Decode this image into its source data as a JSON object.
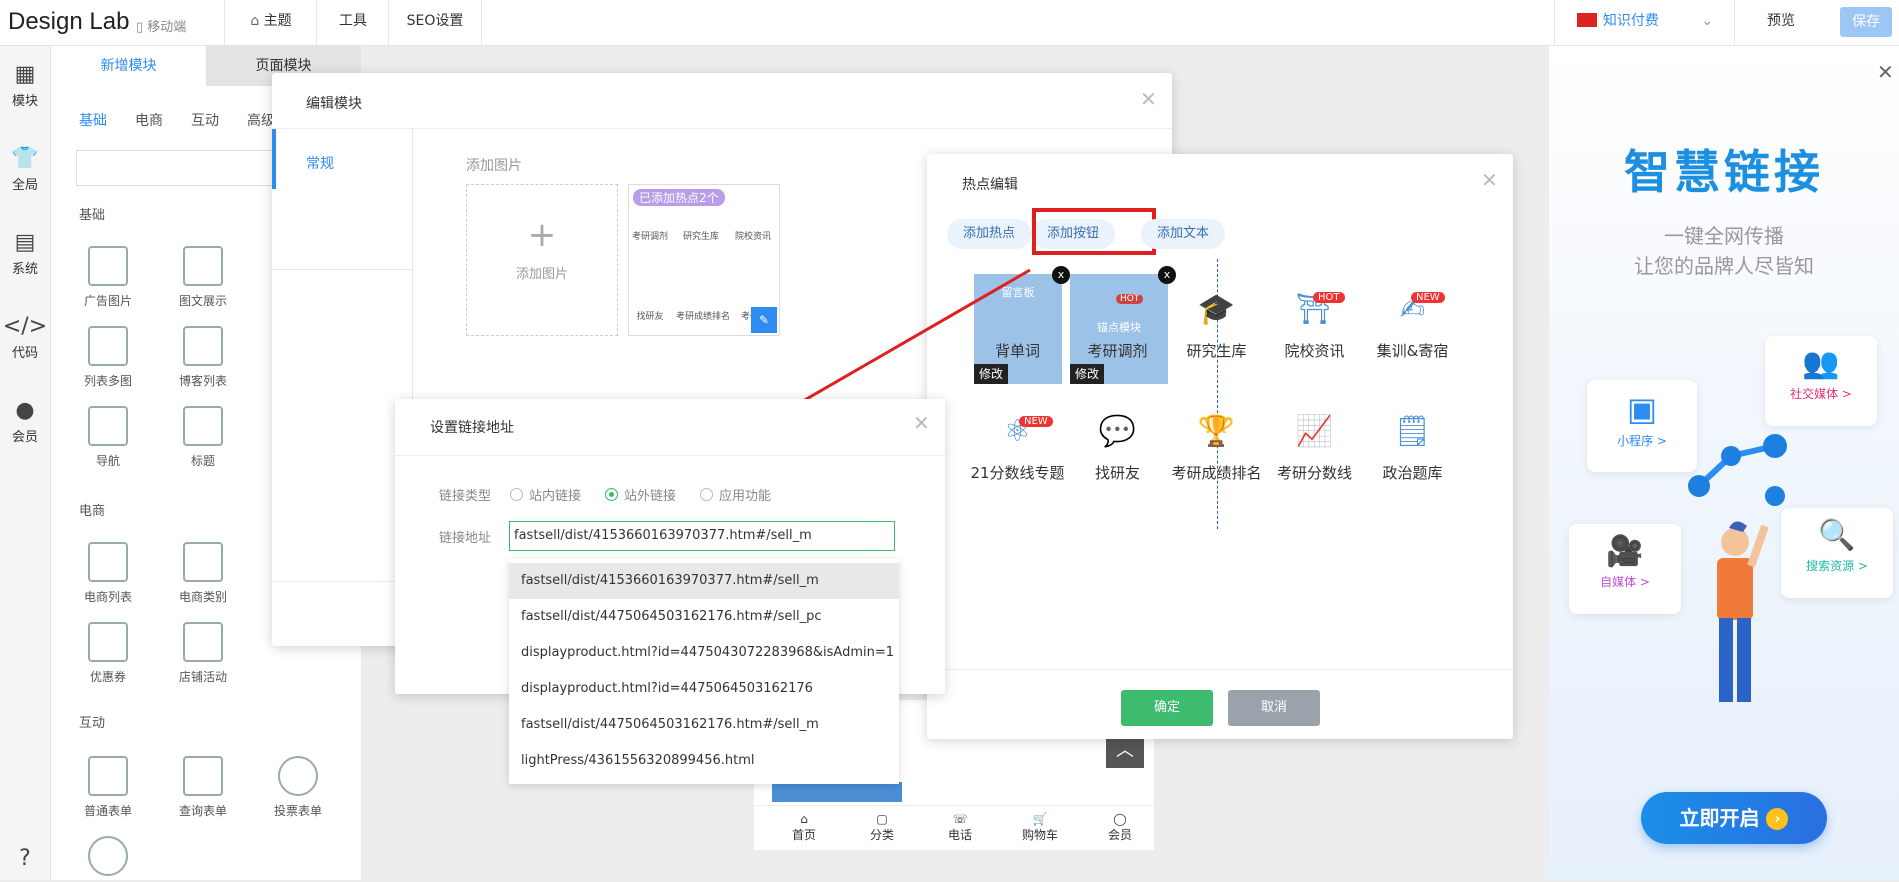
{
  "app": {
    "title": "Design Lab",
    "mobile_label": "移动端"
  },
  "topnav": {
    "theme": "主题",
    "tools": "工具",
    "seo": "SEO设置",
    "knowledge": "知识付费",
    "preview": "预览",
    "save": "保存"
  },
  "iconbar": [
    {
      "label": "模块",
      "icon": "grid-icon"
    },
    {
      "label": "全局",
      "icon": "shirt-icon"
    },
    {
      "label": "系统",
      "icon": "document-icon"
    },
    {
      "label": "代码",
      "icon": "code-icon"
    },
    {
      "label": "会员",
      "icon": "user-icon"
    }
  ],
  "module_panel": {
    "tabs": [
      "新增模块",
      "页面模块"
    ],
    "categories": [
      "基础",
      "电商",
      "互动",
      "高级"
    ],
    "sections": {
      "basic": "基础",
      "ecommerce": "电商",
      "interactive": "互动"
    },
    "basic_modules": [
      "广告图片",
      "图文展示",
      "列表多图",
      "博客列表",
      "导航",
      "标题"
    ],
    "ecommerce_modules": [
      "电商列表",
      "电商类别",
      "优惠券",
      "店铺活动"
    ],
    "interactive_modules": [
      "普通表单",
      "查询表单",
      "投票表单"
    ]
  },
  "edit_module": {
    "title": "编辑模块",
    "side_tab": "常规",
    "add_image_label": "添加图片",
    "add_image_box": "添加图片",
    "added_hotspots": "已添加热点2个",
    "thumb_items": [
      "考研调剂",
      "研究生库",
      "院校资讯",
      "找研友",
      "考研成绩排名",
      "考研"
    ]
  },
  "hotspot_editor": {
    "title": "热点编辑",
    "buttons": [
      "添加热点",
      "添加按钮",
      "添加文本"
    ],
    "items_row1": [
      "背单词",
      "考研调剂",
      "研究生库",
      "院校资讯",
      "集训&寄宿"
    ],
    "items_row2": [
      "21分数线专题",
      "找研友",
      "考研成绩排名",
      "考研分数线",
      "政治题库"
    ],
    "edit_tag": "修改",
    "badge_hot": "HOT",
    "badge_new": "NEW",
    "confirm": "确定",
    "cancel": "取消",
    "tile_sub1": "留言板",
    "tile_sub2": "锚点模块"
  },
  "link_dialog": {
    "title": "设置链接地址",
    "type_label": "链接类型",
    "types": [
      "站内链接",
      "站外链接",
      "应用功能"
    ],
    "selected_type": "站外链接",
    "addr_label": "链接地址",
    "addr_value": "fastsell/dist/4153660163970377.htm#/sell_m",
    "suggestions": [
      "fastsell/dist/4153660163970377.htm#/sell_m",
      "fastsell/dist/4475064503162176.htm#/sell_pc",
      "displayproduct.html?id=4475043072283968&isAdmin=1",
      "displayproduct.html?id=4475064503162176",
      "fastsell/dist/4475064503162176.htm#/sell_m",
      "lightPress/4361556320899456.html"
    ]
  },
  "phone_preview": {
    "nav": [
      "首页",
      "分类",
      "电话",
      "购物车",
      "会员"
    ]
  },
  "banner": {
    "title": "智慧链接",
    "line1": "一键全网传播",
    "line2": "让您的品牌人尽皆知",
    "tags": [
      "社交媒体 >",
      "小程序 >",
      "自媒体 >",
      "搜索资源 >"
    ],
    "cta": "立即开启"
  },
  "colors": {
    "accent_blue": "#2d8cf0",
    "green": "#3dbb6e",
    "red_box": "#e02020",
    "gray_btn": "#9aa3ab"
  }
}
